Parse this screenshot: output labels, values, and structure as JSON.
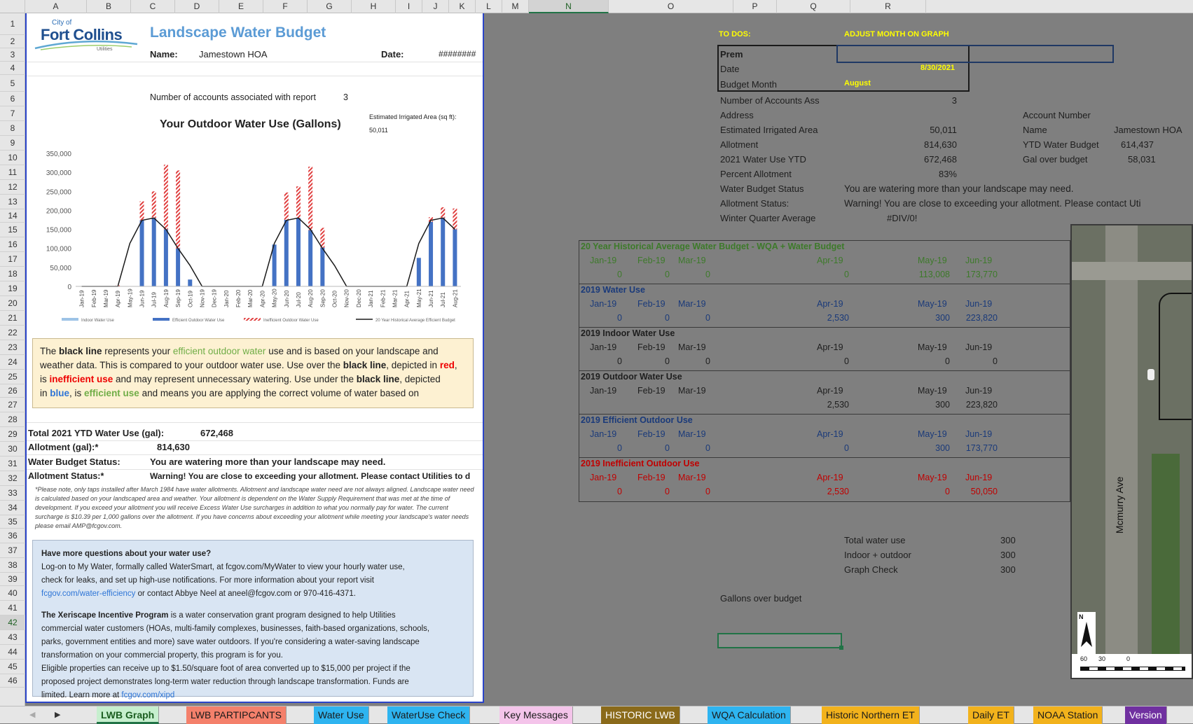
{
  "columns": [
    "A",
    "B",
    "C",
    "D",
    "E",
    "F",
    "G",
    "H",
    "I",
    "J",
    "K",
    "L",
    "M",
    "N",
    "O",
    "P",
    "Q",
    "R"
  ],
  "rows": [
    "1",
    "2",
    "3",
    "4",
    "5",
    "6",
    "7",
    "8",
    "9",
    "10",
    "11",
    "12",
    "13",
    "14",
    "15",
    "16",
    "17",
    "18",
    "19",
    "20",
    "21",
    "22",
    "23",
    "24",
    "25",
    "26",
    "27",
    "28",
    "29",
    "30",
    "31",
    "32",
    "33",
    "34",
    "35",
    "36",
    "37",
    "38",
    "39",
    "40",
    "41",
    "42",
    "43",
    "44",
    "45",
    "46"
  ],
  "logo": {
    "city": "City of",
    "name": "Fort Collins",
    "sub": "Utilities"
  },
  "report": {
    "title": "Landscape Water Budget",
    "name_label": "Name:",
    "name_value": "Jamestown HOA",
    "date_label": "Date:",
    "date_value": "########",
    "accounts_label": "Number of accounts associated with report",
    "accounts_value": "3",
    "chart_title": "Your Outdoor Water Use (Gallons)",
    "area_label": "Estimated Irrigated Area (sq ft):",
    "area_value": "50,011",
    "info_text": {
      "p1": "The ",
      "bl1": "black line",
      "p2": " represents your ",
      "eff1": "efficient outdoor water",
      "p3": " use and is based on your landscape and",
      "l2a": "weather data.  This is compared to your outdoor water use. Use over the ",
      "bl2": "black line",
      "l2b": ", depicted in ",
      "red": "red",
      "l3a": "is ",
      "ineff": "inefficient use",
      "l3b": " and may represent unnecessary watering.  Use under the ",
      "bl3": "black line",
      "l3c": ", depicted",
      "l4a": "in ",
      "blue": "blue",
      "l4b": ", is ",
      "eff2": "efficient use",
      "l4c": " and means you are applying the correct volume of water based on"
    },
    "total_label": "Total 2021 YTD Water Use (gal):",
    "total_value": "672,468",
    "allot_label": "Allotment (gal):*",
    "allot_value": "814,630",
    "status_label": "Water Budget Status:",
    "status_value": "You are watering more than your landscape may need.",
    "allot_status_label": "Allotment Status:*",
    "allot_status_value": "Warning! You are close to exceeding your allotment. Please contact Utilities to d",
    "fine_print": "*Please note, only taps installed after March 1984 have water allotments. Allotment and landscape water need are not always aligned. Landscape water need is calculated based on your landscaped area and weather. Your allotment is dependent on the Water Supply Requirement that was met at the time of development. If you exceed your allotment you will receive Excess Water Use surcharges in addition to what you normally pay for water. The current surcharge is $10.39 per 1,000 gallons over the allotment. If you have concerns about exceeding your allotment while meeting your landscape's water needs please email AMP@fcgov.com.",
    "q_title": "Have more questions about your water use?",
    "q_l1": "Log-on to My Water, formally called WaterSmart, at fcgov.com/MyWater to view your hourly water use,",
    "q_l2": "check for leaks, and set up high-use notifications. For more information about your report visit",
    "q_l3_link": "fcgov.com/water-efficiency",
    "q_l3": " or contact Abbye Neel at aneel@fcgov.com or 970-416-4371.",
    "x_title": "The Xeriscape Incentive Program",
    "x_l1": " is a water conservation grant program designed to help Utilities",
    "x_l2": "commercial water customers (HOAs, multi-family complexes, businesses, faith-based organizations, schools,",
    "x_l3": "parks, government entities and more) save water outdoors. If you're considering a water-saving landscape",
    "x_l4": "transformation on your commercial property, this program is for you.",
    "x_l5": "Eligible properties can receive up to $1.50/square foot of area converted up to $15,000 per project if the",
    "x_l6": "proposed project demonstrates long-term water reduction through landscape transformation. Funds are",
    "x_l7": "limited. Learn more at ",
    "x_link": "fcgov.com/xipd"
  },
  "chart_data": {
    "type": "bar",
    "categories": [
      "Jan-19",
      "Feb-19",
      "Mar-19",
      "Apr-19",
      "May-19",
      "Jun-19",
      "Jul-19",
      "Aug-19",
      "Sep-19",
      "Oct-19",
      "Nov-19",
      "Dec-19",
      "Jan-20",
      "Feb-20",
      "Mar-20",
      "Apr-20",
      "May-20",
      "Jun-20",
      "Jul-20",
      "Aug-20",
      "Sep-20",
      "Oct-20",
      "Nov-20",
      "Dec-20",
      "Jan-21",
      "Feb-21",
      "Mar-21",
      "Apr-21",
      "May-21",
      "Jun-21",
      "Jul-21",
      "Aug-21"
    ],
    "ylim": [
      0,
      350000
    ],
    "yticks": [
      "350,000",
      "300,000",
      "250,000",
      "200,000",
      "150,000",
      "100,000",
      "50,000",
      "0"
    ],
    "series": [
      {
        "name": "Indoor Water Use",
        "values": [
          0,
          0,
          0,
          0,
          0,
          0,
          0,
          0,
          0,
          0,
          0,
          0,
          0,
          0,
          0,
          0,
          0,
          0,
          0,
          0,
          0,
          0,
          0,
          0,
          0,
          0,
          0,
          0,
          0,
          0,
          0,
          0
        ]
      },
      {
        "name": "Efficient Outdoor Water Use",
        "values": [
          0,
          0,
          0,
          0,
          300,
          173770,
          180000,
          150000,
          100000,
          18000,
          0,
          0,
          0,
          0,
          0,
          0,
          110000,
          175000,
          180000,
          148000,
          102000,
          0,
          0,
          0,
          0,
          0,
          0,
          0,
          75000,
          170000,
          180000,
          150000
        ]
      },
      {
        "name": "Inefficient Outdoor Water Use",
        "values": [
          0,
          0,
          0,
          2530,
          0,
          50050,
          70000,
          170000,
          205000,
          0,
          0,
          0,
          0,
          0,
          0,
          0,
          0,
          72000,
          83000,
          167000,
          52000,
          0,
          0,
          0,
          0,
          0,
          0,
          0,
          0,
          12000,
          28000,
          55000
        ]
      },
      {
        "name": "20 Year Historical Average Efficient Budget",
        "values": [
          0,
          0,
          0,
          0,
          113008,
          173770,
          180000,
          150000,
          100000,
          55000,
          0,
          0,
          0,
          0,
          0,
          0,
          113008,
          173770,
          180000,
          150000,
          100000,
          55000,
          0,
          0,
          0,
          0,
          0,
          0,
          113008,
          173770,
          180000,
          150000
        ]
      }
    ],
    "colors": {
      "indoor": "#9dc3e6",
      "efficient": "#4472c4",
      "inefficient": "#e04040",
      "line": "#1a1a1a"
    }
  },
  "right": {
    "todo": "TO DOS:",
    "adjust": "ADJUST MONTH ON GRAPH",
    "prem": "Prem",
    "date": "Date",
    "date_val": "8/30/2021",
    "budget_month": "Budget Month",
    "budget_month_val": "August",
    "rows": [
      {
        "label": "Number of Accounts Ass",
        "value": "3"
      },
      {
        "label": "Address",
        "value": ""
      },
      {
        "label": "Estimated Irrigated Area",
        "value": "50,011"
      },
      {
        "label": "Allotment",
        "value": "814,630"
      },
      {
        "label": "2021 Water Use YTD",
        "value": "672,468"
      },
      {
        "label": "Percent Allotment",
        "value": "83%"
      }
    ],
    "wbs_label": "Water Budget Status",
    "wbs_value": "You are watering more than your landscape may need.",
    "as_label": "Allotment Status:",
    "as_value": "Warning! You are close to exceeding your allotment. Please contact Uti",
    "wqa_label": "Winter Quarter Average",
    "wqa_value": "#DIV/0!",
    "acct_label": "Account Number",
    "name_label": "Name",
    "name_value": "Jamestown HOA",
    "ytd_label": "YTD Water Budget",
    "ytd_value": "614,437",
    "over_label": "Gal over budget",
    "over_value": "58,031",
    "months": [
      "Jan-19",
      "Feb-19",
      "Mar-19",
      "Apr-19",
      "May-19",
      "Jun-19"
    ],
    "sections": [
      {
        "title": "20 Year Historical Average Water Budget - WQA + Water Budget",
        "values": [
          "0",
          "0",
          "0",
          "0",
          "113,008",
          "173,770"
        ],
        "cls": "grn"
      },
      {
        "title": "2019 Water Use",
        "values": [
          "0",
          "0",
          "0",
          "2,530",
          "300",
          "223,820"
        ],
        "cls": "blu"
      },
      {
        "title": "2019 Indoor Water Use",
        "values": [
          "0",
          "0",
          "0",
          "0",
          "0",
          "0"
        ],
        "cls": "gy"
      },
      {
        "title": "2019 Outdoor Water Use",
        "values": [
          "",
          "",
          "",
          "2,530",
          "300",
          "223,820"
        ],
        "cls": "gy"
      },
      {
        "title": "2019 Efficient Outdoor Use",
        "values": [
          "0",
          "0",
          "0",
          "0",
          "300",
          "173,770"
        ],
        "cls": "blu"
      },
      {
        "title": "2019 Inefficient Outdoor Use",
        "values": [
          "0",
          "0",
          "0",
          "2,530",
          "0",
          "50,050"
        ],
        "cls": "red"
      }
    ],
    "total_use": "Total water use",
    "total_use_v": "300",
    "indoor_outdoor": "Indoor + outdoor",
    "indoor_outdoor_v": "300",
    "graph_check": "Graph Check",
    "graph_check_v": "300",
    "gallons_over": "Gallons over budget"
  },
  "map": {
    "street": "Mcmurry Ave",
    "north": "N",
    "scale": [
      "60",
      "30",
      "0"
    ]
  },
  "tabs": [
    {
      "label": "LWB Graph",
      "color": "#c6efce",
      "active": true
    },
    {
      "label": "LWB PARTIPCANTS",
      "color": "#f4806b"
    },
    {
      "label": "Water Use",
      "color": "#2eb4f0"
    },
    {
      "label": "WaterUse Check",
      "color": "#2eb4f0"
    },
    {
      "label": "Key Messages",
      "color": "#f4c4ea"
    },
    {
      "label": "HISTORIC LWB",
      "color": "#8a6a1a"
    },
    {
      "label": "WQA Calculation",
      "color": "#2eb4f0"
    },
    {
      "label": "Historic Northern ET",
      "color": "#f2b21c"
    },
    {
      "label": "Daily ET",
      "color": "#f2b21c"
    },
    {
      "label": "NOAA Station",
      "color": "#f2b21c"
    },
    {
      "label": "Version",
      "color": "#7030a0"
    }
  ]
}
